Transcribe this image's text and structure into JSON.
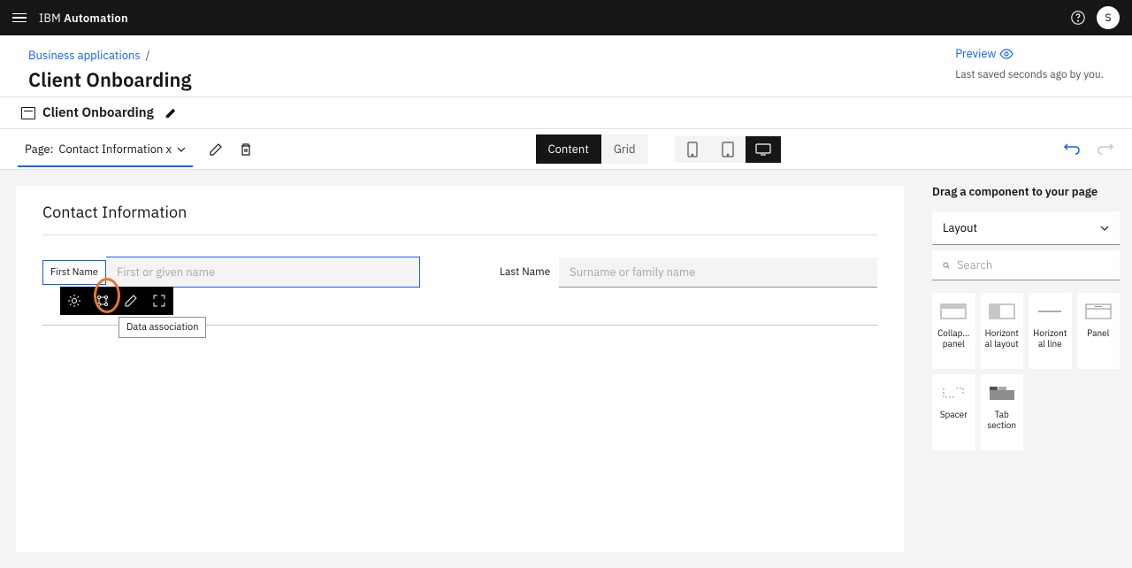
{
  "header": {
    "brand_prefix": "IBM ",
    "brand_bold": "Automation",
    "avatar_initial": "S"
  },
  "breadcrumb": {
    "link": "Business applications",
    "sep": "/",
    "title": "Client Onboarding",
    "preview": "Preview",
    "saved": "Last saved seconds ago by you."
  },
  "subheader": {
    "title": "Client Onboarding"
  },
  "toolbar": {
    "page_label": "Page:",
    "page_name": "Contact Information x",
    "content_btn": "Content",
    "grid_btn": "Grid"
  },
  "canvas": {
    "title": "Contact Information",
    "first_name_label": "First Name",
    "first_name_placeholder": "First or given name",
    "last_name_label": "Last Name",
    "last_name_placeholder": "Surname or family name",
    "tooltip": "Data association"
  },
  "panel": {
    "title": "Drag a component to your page",
    "layout_label": "Layout",
    "search_placeholder": "Search",
    "components": {
      "collapsible": "Collap... panel",
      "hlayout": "Horizontal layout",
      "hline": "Horizontal line",
      "panel_c": "Panel",
      "spacer": "Spacer",
      "tab": "Tab section"
    }
  }
}
